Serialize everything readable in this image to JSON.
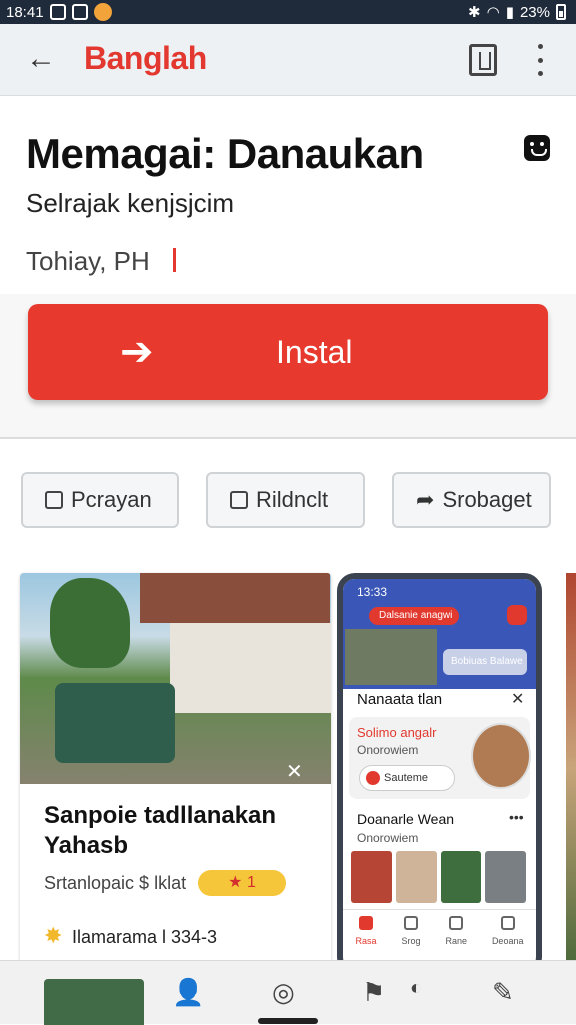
{
  "status_bar": {
    "time": "18:41",
    "battery": "23%"
  },
  "app_bar": {
    "title": "Banglah",
    "back_icon": "back-arrow-icon",
    "doc_icon": "document-icon",
    "more_icon": "more-vertical-icon"
  },
  "header": {
    "title": "Memagai: Danaukan",
    "subtitle": "Selrajak kenjsjcim",
    "meta": "Tohiay, PH"
  },
  "install": {
    "label": "Instal"
  },
  "chips": [
    {
      "label": "Pcrayan",
      "icon": "calendar-icon"
    },
    {
      "label": "Rildnclt",
      "icon": "chat-icon"
    },
    {
      "label": "Srobaget",
      "icon": "share-icon"
    }
  ],
  "card": {
    "title": "Sanpoie tadllanakan Yahasb",
    "meta": "Srtanlopaic $ lklat",
    "rating": "1",
    "author": "Ilamarama l 334-3"
  },
  "phone": {
    "time": "13:33",
    "pill": "Dalsanie anagwi",
    "pill2": "Bobiuas Balawe",
    "dialog_title": "Nanaata tlan",
    "row_title": "Solimo angalr",
    "row_sub": "Onorowiem",
    "row_btn": "Sauteme",
    "section_title": "Doanarle Wean",
    "section_sub": "Onorowiem",
    "nav": [
      "Rasa",
      "Srog",
      "Rane",
      "Deoana"
    ]
  }
}
